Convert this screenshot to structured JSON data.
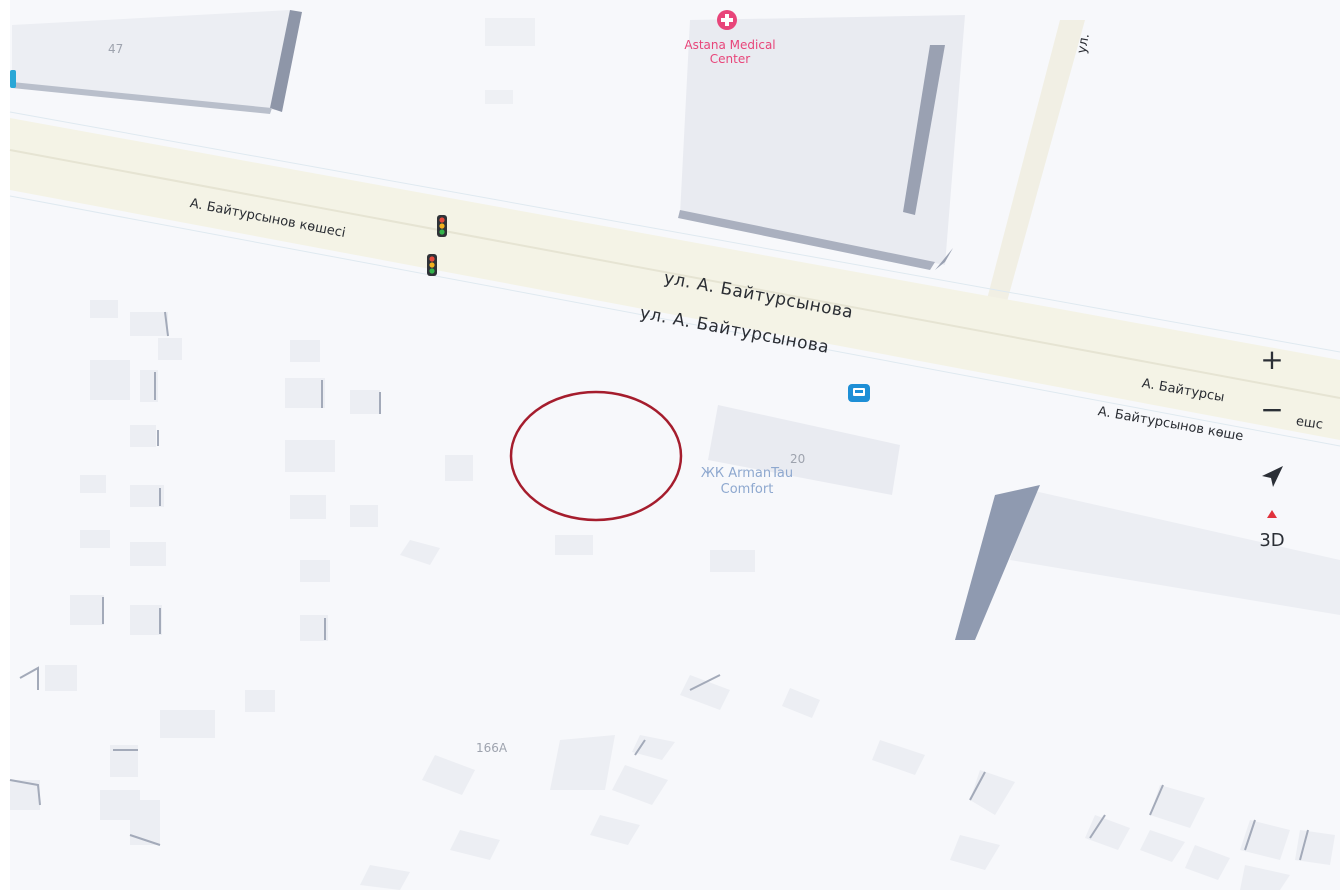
{
  "map": {
    "streets": {
      "street_kz_left": "А. Байтурсынов көшесі",
      "street_ru_upper": "ул. А. Байтурсынова",
      "street_ru_lower": "ул. А. Байтурсынова",
      "street_kz_right_1": "А. Байтурсы",
      "street_kz_right_2": "А. Байтурсынов көше",
      "street_vertical": "ул."
    },
    "buildings": {
      "num_47": "47",
      "num_20": "20",
      "num_166a": "166А",
      "partial_right": "ешс"
    },
    "pois": {
      "medical_line1": "Astana Medical",
      "medical_line2": "Center",
      "complex_line1": "ЖК ArmanTau",
      "complex_line2": "Comfort"
    },
    "colors": {
      "medical": "#e8457a",
      "complex": "#8ea8cf",
      "bus_stop": "#1e8fd6",
      "circle": "#a51d2d",
      "compass": "#e0323c"
    }
  },
  "controls": {
    "zoom_in": "+",
    "zoom_out": "−",
    "mode_3d": "3D"
  }
}
